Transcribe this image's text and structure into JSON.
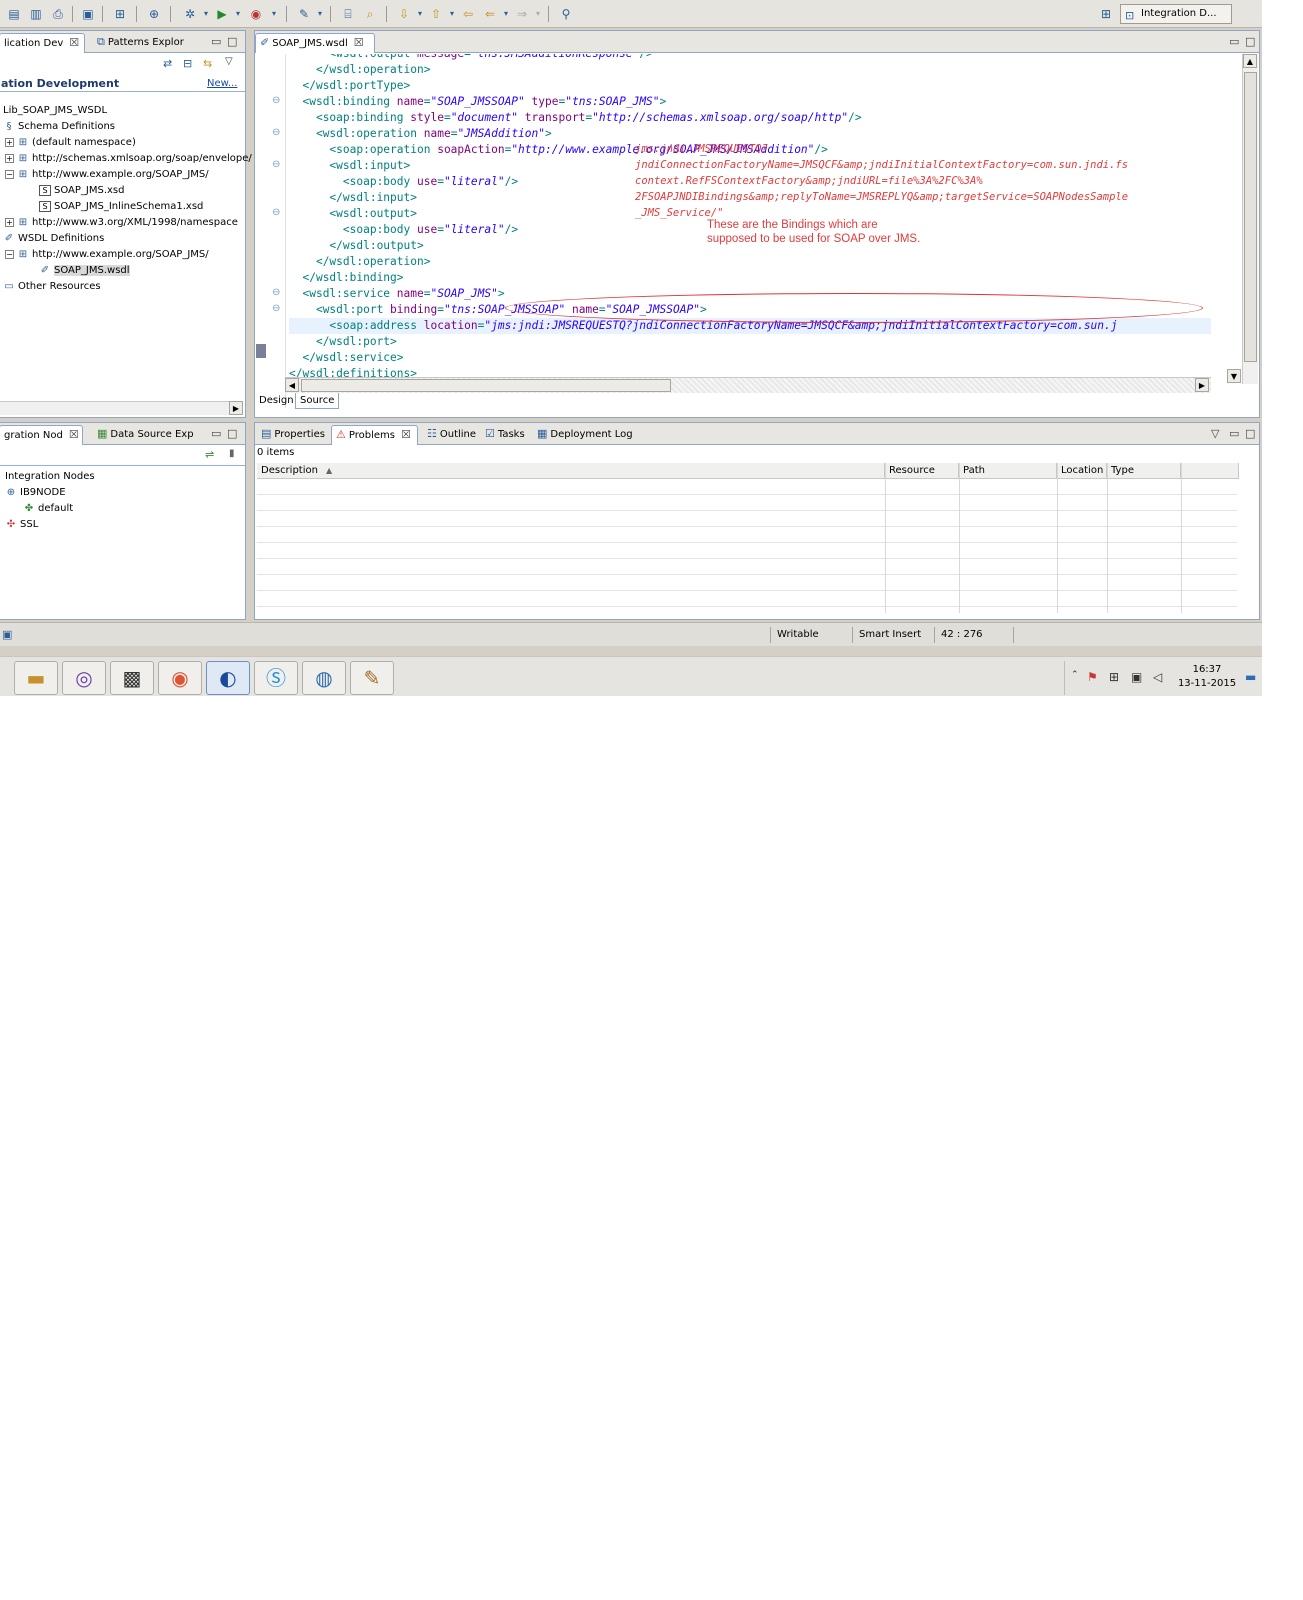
{
  "perspective": {
    "label": "Integration D..."
  },
  "left_top": {
    "tabs": [
      {
        "label": "lication Dev",
        "close": "☒"
      },
      {
        "label": "Patterns Explor"
      }
    ],
    "header": "ation Development",
    "new_link": "New...",
    "tree": [
      {
        "label": "Lib_SOAP_JMS_WSDL"
      },
      {
        "label": "Schema Definitions",
        "icon": "schema-icon"
      },
      {
        "label": "(default namespace)",
        "exp": "+"
      },
      {
        "label": "http://schemas.xmlsoap.org/soap/envelope/",
        "exp": "+"
      },
      {
        "label": "http://www.example.org/SOAP_JMS/",
        "exp": "−"
      },
      {
        "label": "SOAP_JMS.xsd",
        "icon": "xsd-icon"
      },
      {
        "label": "SOAP_JMS_InlineSchema1.xsd",
        "icon": "xsd-icon"
      },
      {
        "label": "http://www.w3.org/XML/1998/namespace",
        "exp": "+"
      },
      {
        "label": "WSDL Definitions",
        "icon": "wsdl-folder-icon"
      },
      {
        "label": "http://www.example.org/SOAP_JMS/",
        "exp": "−"
      },
      {
        "label": "SOAP_JMS.wsdl",
        "icon": "wsdl-icon"
      },
      {
        "label": "Other Resources",
        "icon": "folder-icon"
      }
    ]
  },
  "editor": {
    "tab": "SOAP_JMS.wsdl",
    "lines": [
      {
        "indent": "      ",
        "parts": [
          [
            "k",
            "<wsdl:output "
          ],
          [
            "a",
            "message"
          ],
          [
            "k",
            "="
          ],
          [
            "v",
            "\"tns:JMSAdditionResponse\""
          ],
          [
            "k",
            "/>"
          ]
        ]
      },
      {
        "indent": "    ",
        "parts": [
          [
            "k",
            "</wsdl:operation>"
          ]
        ]
      },
      {
        "indent": "  ",
        "parts": [
          [
            "k",
            "</wsdl:portType>"
          ]
        ]
      },
      {
        "indent": "  ",
        "parts": [
          [
            "k",
            "<wsdl:binding "
          ],
          [
            "a",
            "name"
          ],
          [
            "k",
            "="
          ],
          [
            "v",
            "\"SOAP_JMSSOAP\""
          ],
          [
            "k",
            " "
          ],
          [
            "a",
            "type"
          ],
          [
            "k",
            "="
          ],
          [
            "v",
            "\"tns:SOAP_JMS\""
          ],
          [
            "k",
            ">"
          ]
        ]
      },
      {
        "indent": "    ",
        "parts": [
          [
            "k",
            "<soap:binding "
          ],
          [
            "a",
            "style"
          ],
          [
            "k",
            "="
          ],
          [
            "v",
            "\"document\""
          ],
          [
            "k",
            " "
          ],
          [
            "a",
            "transport"
          ],
          [
            "k",
            "="
          ],
          [
            "v",
            "\"http://schemas.xmlsoap.org/soap/http\""
          ],
          [
            "k",
            "/>"
          ]
        ]
      },
      {
        "indent": "    ",
        "parts": [
          [
            "k",
            "<wsdl:operation "
          ],
          [
            "a",
            "name"
          ],
          [
            "k",
            "="
          ],
          [
            "v",
            "\"JMSAddition\""
          ],
          [
            "k",
            ">"
          ]
        ]
      },
      {
        "indent": "      ",
        "parts": [
          [
            "k",
            "<soap:operation "
          ],
          [
            "a",
            "soapAction"
          ],
          [
            "k",
            "="
          ],
          [
            "v",
            "\"http://www.example.org/SOAP_JMS/JMSAddition\""
          ],
          [
            "k",
            "/>"
          ]
        ]
      },
      {
        "indent": "      ",
        "parts": [
          [
            "k",
            "<wsdl:input>"
          ]
        ]
      },
      {
        "indent": "        ",
        "parts": [
          [
            "k",
            "<soap:body "
          ],
          [
            "a",
            "use"
          ],
          [
            "k",
            "="
          ],
          [
            "v",
            "\"literal\""
          ],
          [
            "k",
            "/>"
          ]
        ]
      },
      {
        "indent": "      ",
        "parts": [
          [
            "k",
            "</wsdl:input>"
          ]
        ]
      },
      {
        "indent": "      ",
        "parts": [
          [
            "k",
            "<wsdl:output>"
          ]
        ]
      },
      {
        "indent": "        ",
        "parts": [
          [
            "k",
            "<soap:body "
          ],
          [
            "a",
            "use"
          ],
          [
            "k",
            "="
          ],
          [
            "v",
            "\"literal\""
          ],
          [
            "k",
            "/>"
          ]
        ]
      },
      {
        "indent": "      ",
        "parts": [
          [
            "k",
            "</wsdl:output>"
          ]
        ]
      },
      {
        "indent": "    ",
        "parts": [
          [
            "k",
            "</wsdl:operation>"
          ]
        ]
      },
      {
        "indent": "  ",
        "parts": [
          [
            "k",
            "</wsdl:binding>"
          ]
        ]
      },
      {
        "indent": "  ",
        "parts": [
          [
            "k",
            "<wsdl:service "
          ],
          [
            "a",
            "name"
          ],
          [
            "k",
            "="
          ],
          [
            "v",
            "\"SOAP_JMS\""
          ],
          [
            "k",
            ">"
          ]
        ]
      },
      {
        "indent": "    ",
        "parts": [
          [
            "k",
            "<wsdl:port "
          ],
          [
            "a",
            "binding"
          ],
          [
            "k",
            "="
          ],
          [
            "v",
            "\"tns:SOAP_JMSSOAP\""
          ],
          [
            "k",
            " "
          ],
          [
            "a",
            "name"
          ],
          [
            "k",
            "="
          ],
          [
            "v",
            "\"SOAP_JMSSOAP\""
          ],
          [
            "k",
            ">"
          ]
        ]
      },
      {
        "indent": "      ",
        "parts": [
          [
            "k",
            "<soap:address "
          ],
          [
            "a",
            "location"
          ],
          [
            "k",
            "="
          ],
          [
            "v",
            "\"jms:jndi:JMSREQUESTQ?jndiConnectionFactoryName=JMSQCF&amp;jndiInitialContextFactory=com.sun.j"
          ]
        ],
        "highlight": true
      },
      {
        "indent": "    ",
        "parts": [
          [
            "k",
            "</wsdl:port>"
          ]
        ]
      },
      {
        "indent": "  ",
        "parts": [
          [
            "k",
            "</wsdl:service>"
          ]
        ]
      },
      {
        "indent": "",
        "parts": [
          [
            "k",
            "</wsdl:definitions>"
          ]
        ]
      }
    ],
    "tooltip": "jms:jndi:JMSREQUESTQ?\njndiConnectionFactoryName=JMSQCF&amp;jndiInitialContextFactory=com.sun.jndi.fs\ncontext.RefFSContextFactory&amp;jndiURL=file%3A%2FC%3A%\n2FSOAPJNDIBindings&amp;replyToName=JMSREPLYQ&amp;targetService=SOAPNodesSample\n_JMS_Service/\"",
    "note": "These are the Bindings which are\nsupposed to be used for SOAP over JMS.",
    "bottom_tabs": [
      "Design",
      "Source"
    ]
  },
  "left_bottom": {
    "tabs": [
      {
        "label": "gration Nod",
        "close": "☒"
      },
      {
        "label": "Data Source Exp"
      }
    ],
    "tree": [
      {
        "label": "Integration Nodes"
      },
      {
        "label": "IB9NODE",
        "icon": "node-icon"
      },
      {
        "label": "default",
        "icon": "server-icon"
      },
      {
        "label": "SSL",
        "icon": "ssl-icon"
      }
    ]
  },
  "problems": {
    "tabs": [
      "Properties",
      "Problems",
      "Outline",
      "Tasks",
      "Deployment Log"
    ],
    "count": "0 items",
    "columns": [
      "Description",
      "Resource",
      "Path",
      "Location",
      "Type"
    ]
  },
  "status": {
    "writable": "Writable",
    "insert": "Smart Insert",
    "position": "42 : 276"
  },
  "clock": {
    "time": "16:37",
    "date": "13-11-2015"
  }
}
